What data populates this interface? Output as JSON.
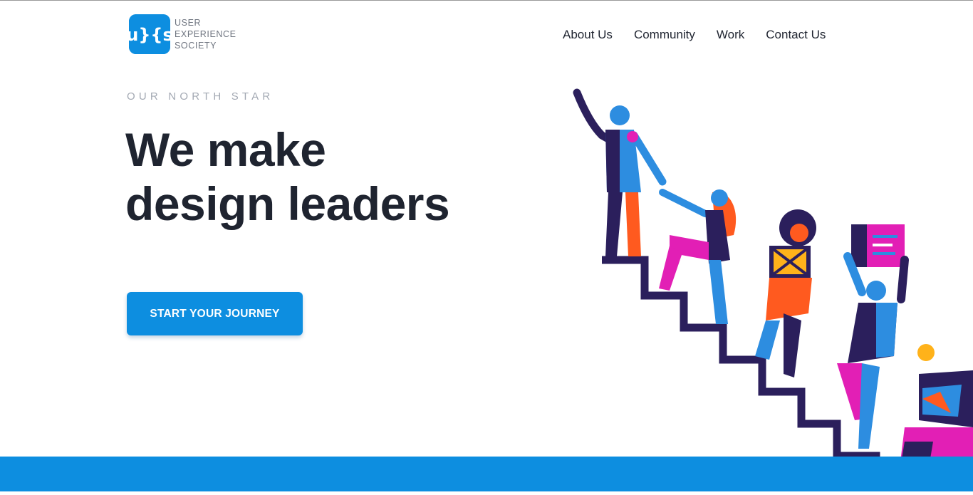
{
  "colors": {
    "brand_blue": "#0d8ee0",
    "headline": "#1f2430",
    "eyebrow": "#a3a9b3",
    "stairs": "#2b1f5c",
    "figure_blue": "#2d8de0",
    "figure_orange": "#ff5a1f",
    "figure_magenta": "#e21fb5"
  },
  "header": {
    "logo": {
      "mark_text": "u}{s",
      "line1": "USER",
      "line2": "EXPERIENCE",
      "line3": "SOCIETY"
    },
    "nav": [
      {
        "label": "About Us"
      },
      {
        "label": "Community"
      },
      {
        "label": "Work"
      },
      {
        "label": "Contact Us"
      }
    ]
  },
  "hero": {
    "eyebrow": "OUR NORTH STAR",
    "headline_line1": "We make",
    "headline_line2": "design leaders",
    "cta_label": "START YOUR JOURNEY"
  },
  "illustration": {
    "icon": "people-climbing-stairs-illustration"
  }
}
